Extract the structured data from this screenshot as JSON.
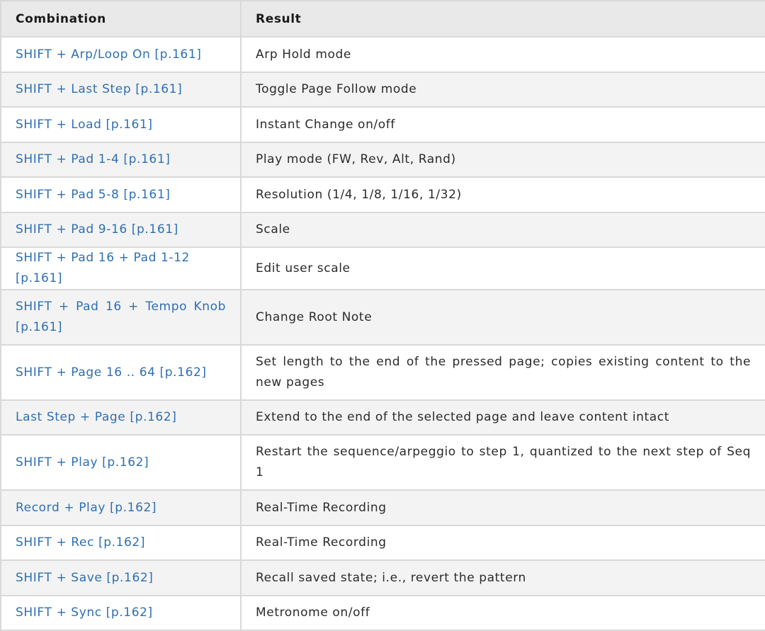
{
  "table": {
    "headers": [
      "Combination",
      "Result"
    ],
    "rows": [
      {
        "combination": "SHIFT + Arp/Loop On [p.161]",
        "result": "Arp Hold mode"
      },
      {
        "combination": "SHIFT + Last Step [p.161]",
        "result": "Toggle Page Follow mode"
      },
      {
        "combination": "SHIFT + Load [p.161]",
        "result": "Instant Change on/off"
      },
      {
        "combination": "SHIFT + Pad 1-4 [p.161]",
        "result": "Play mode (FW, Rev, Alt, Rand)"
      },
      {
        "combination": "SHIFT + Pad 5-8 [p.161]",
        "result": "Resolution (1/4, 1/8, 1/16, 1/32)"
      },
      {
        "combination": "SHIFT + Pad 9-16 [p.161]",
        "result": "Scale"
      },
      {
        "combination": "SHIFT + Pad 16 + Pad 1-12 [p.161]",
        "result": "Edit user scale"
      },
      {
        "combination": "SHIFT + Pad 16 + Tempo Knob [p.161]",
        "result": "Change Root Note"
      },
      {
        "combination": "SHIFT + Page 16 .. 64 [p.162]",
        "result": "Set length to the end of the pressed page; copies existing content to the new pages"
      },
      {
        "combination": "Last Step + Page [p.162]",
        "result": "Extend to the end of the selected page and leave content intact"
      },
      {
        "combination": "SHIFT + Play [p.162]",
        "result": "Restart the sequence/arpeggio to step 1, quantized to the next step of Seq 1"
      },
      {
        "combination": "Record + Play [p.162]",
        "result": "Real-Time Recording"
      },
      {
        "combination": "SHIFT + Rec [p.162]",
        "result": "Real-Time Recording"
      },
      {
        "combination": "SHIFT + Save [p.162]",
        "result": "Recall saved state; i.e., revert the pattern"
      },
      {
        "combination": "SHIFT + Sync [p.162]",
        "result": "Metronome on/off"
      }
    ]
  }
}
